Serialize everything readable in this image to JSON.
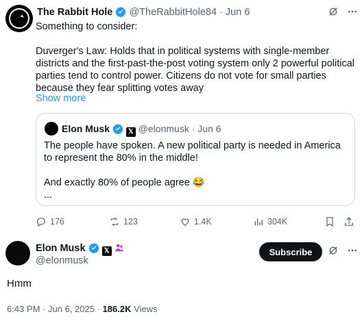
{
  "top_tweet": {
    "author_name": "The Rabbit Hole",
    "handle": "@TheRabbitHole84",
    "separator": "·",
    "date": "Jun 6",
    "body": "Something to consider:\n\nDuverger's Law: Holds that in political systems with single-member districts and the first-past-the-post voting system only 2 powerful political parties tend to control power. Citizens do not vote for small parties because they fear splitting votes away",
    "show_more": "Show more"
  },
  "quoted_tweet": {
    "author_name": "Elon Musk",
    "handle": "@elonmusk",
    "separator": "·",
    "date": "Jun 6",
    "body": "The people have spoken. A new political party is needed in America to represent the 80% in the middle!\n\nAnd exactly 80% of people agree 😂\n..."
  },
  "action_bar": {
    "replies": "176",
    "reposts": "123",
    "likes": "1.4K",
    "views": "304K"
  },
  "reply_tweet": {
    "author_name": "Elon Musk",
    "handle": "@elonmusk",
    "subscribe_label": "Subscribe",
    "body": "Hmm",
    "time": "6:43 PM",
    "separator": "·",
    "date": "Jun 6, 2025",
    "views_count": "186.2K",
    "views_label": "Views"
  },
  "colors": {
    "verified": "#1d9bf0",
    "link": "#1d9bf0",
    "muted": "#536471",
    "grok_badge": "#c13ed8"
  },
  "icons": {
    "grok": "grok-icon",
    "more": "more-icon",
    "reply": "reply-icon",
    "repost": "repost-icon",
    "like": "heart-icon",
    "views": "views-icon",
    "bookmark": "bookmark-icon",
    "share": "share-icon"
  }
}
